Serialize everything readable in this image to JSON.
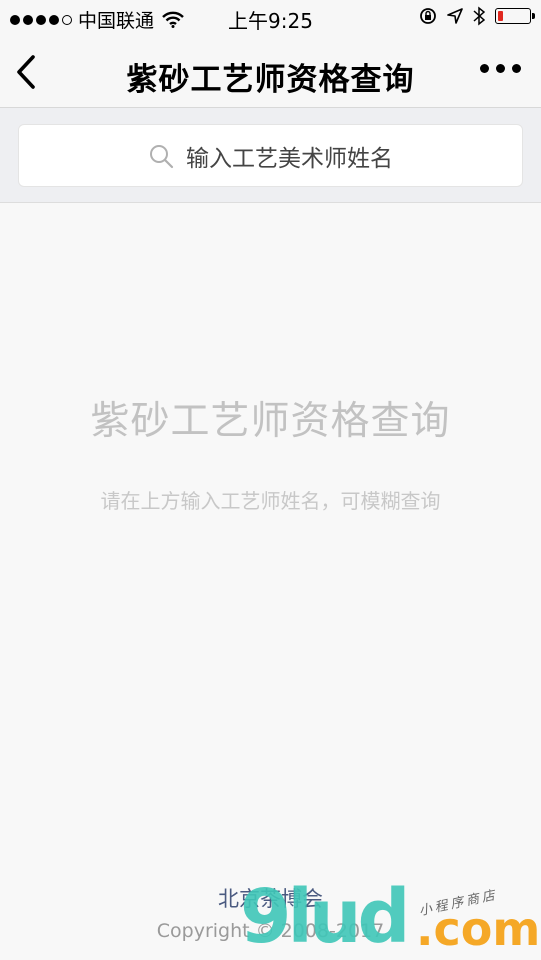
{
  "status_bar": {
    "carrier": "中国联通",
    "time": "上午9:25",
    "battery_level": 0.15,
    "battery_color": "#e0281f"
  },
  "nav": {
    "title": "紫砂工艺师资格查询",
    "back_icon": "chevron-left-icon",
    "more_icon": "more-dots-icon"
  },
  "search": {
    "placeholder": "输入工艺美术师姓名",
    "icon": "search-icon"
  },
  "empty_state": {
    "title": "紫砂工艺师资格查询",
    "hint": "请在上方输入工艺师姓名，可模糊查询"
  },
  "footer": {
    "org": "北京茶博会",
    "copyright": "Copyright © 2008-2017"
  },
  "watermark": {
    "brand": "9lud",
    "domain": ".com",
    "tagline": "小程序商店",
    "colors": {
      "brand": "#3fc7b8",
      "domain": "#f5a41c"
    }
  }
}
